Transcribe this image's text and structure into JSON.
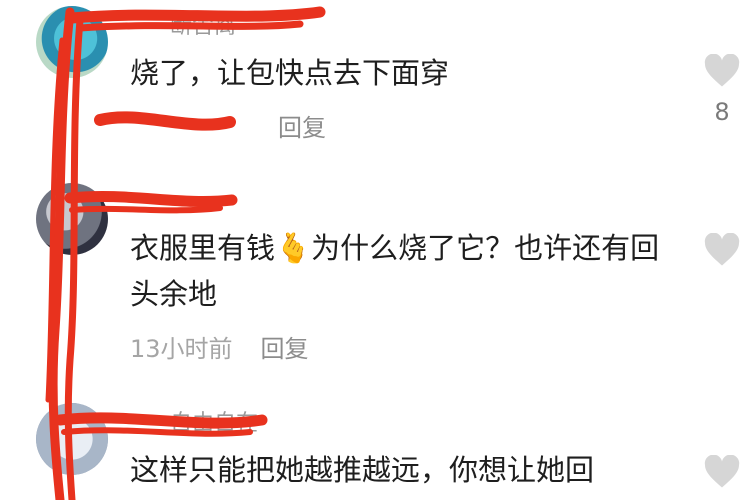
{
  "comments": [
    {
      "username": "断舍离",
      "text": "烧了，让包快点去下面穿",
      "time": "",
      "reply_label": "回复",
      "like_count": "8"
    },
    {
      "username": "",
      "text": "衣服里有钱🫰为什么烧了它？也许还有回头余地",
      "time": "13小时前",
      "reply_label": "回复",
      "like_count": ""
    },
    {
      "username": "自由自在",
      "text": "这样只能把她越推越远，你想让她回",
      "time": "",
      "reply_label": "",
      "like_count": ""
    }
  ],
  "colors": {
    "scribble": "#e8321e",
    "heart": "#d6d6d6",
    "meta_text": "#a5a5a5"
  },
  "icons": [
    "heart-icon",
    "avatar"
  ]
}
